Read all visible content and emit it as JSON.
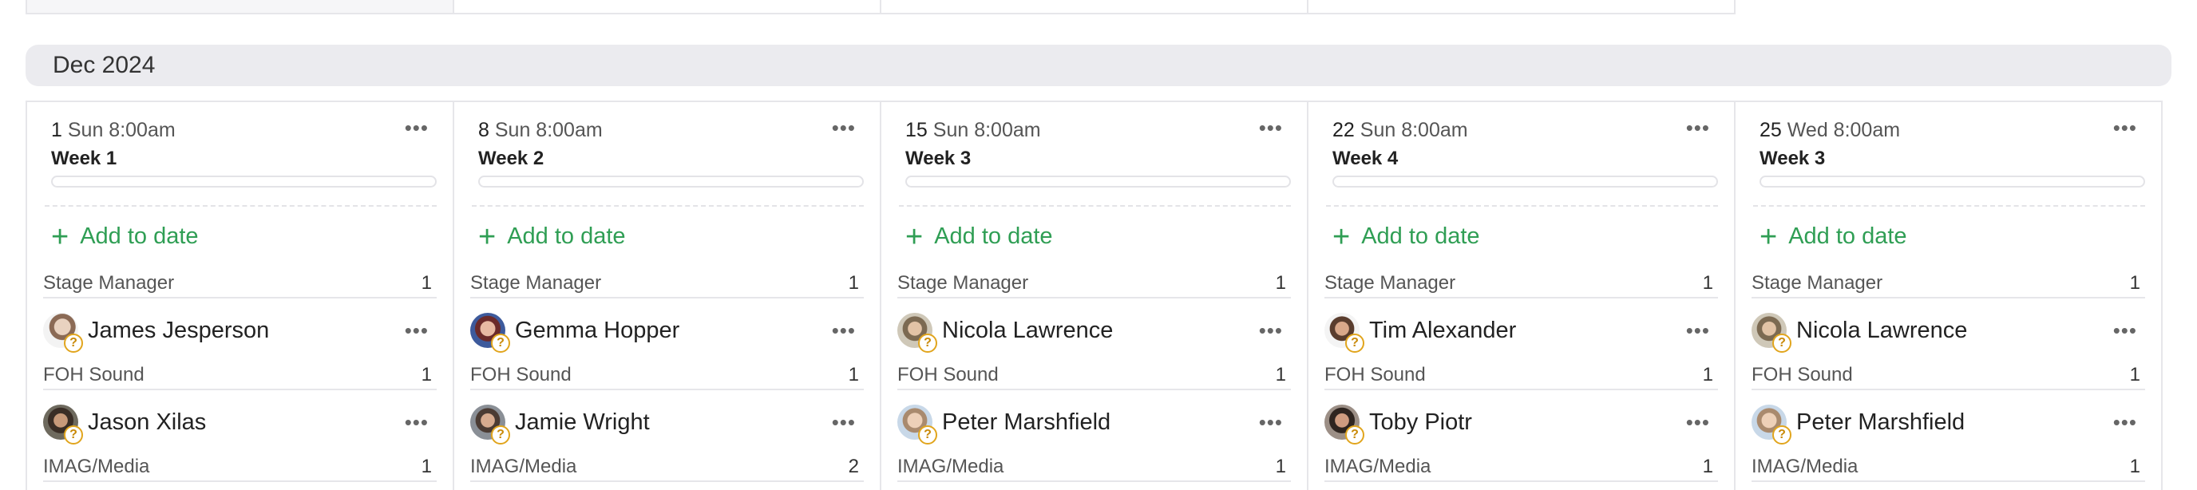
{
  "month": {
    "label": "Dec 2024"
  },
  "columns": [
    {
      "day": "1",
      "weekday_time": "Sun 8:00am",
      "week": "Week 1",
      "add_label": "Add to date",
      "roles": [
        {
          "name": "Stage Manager",
          "count": "1"
        },
        {
          "name": "FOH Sound",
          "count": "1"
        },
        {
          "name": "IMAG/Media",
          "count": "1"
        }
      ],
      "people": [
        {
          "name": "James Jesperson",
          "status": "?"
        },
        {
          "name": "Jason Xilas",
          "status": "?"
        }
      ]
    },
    {
      "day": "8",
      "weekday_time": "Sun 8:00am",
      "week": "Week 2",
      "add_label": "Add to date",
      "roles": [
        {
          "name": "Stage Manager",
          "count": "1"
        },
        {
          "name": "FOH Sound",
          "count": "1"
        },
        {
          "name": "IMAG/Media",
          "count": "2"
        }
      ],
      "people": [
        {
          "name": "Gemma Hopper",
          "status": "?"
        },
        {
          "name": "Jamie Wright",
          "status": "?"
        }
      ]
    },
    {
      "day": "15",
      "weekday_time": "Sun 8:00am",
      "week": "Week 3",
      "add_label": "Add to date",
      "roles": [
        {
          "name": "Stage Manager",
          "count": "1"
        },
        {
          "name": "FOH Sound",
          "count": "1"
        },
        {
          "name": "IMAG/Media",
          "count": "1"
        }
      ],
      "people": [
        {
          "name": "Nicola Lawrence",
          "status": "?"
        },
        {
          "name": "Peter Marshfield",
          "status": "?"
        }
      ]
    },
    {
      "day": "22",
      "weekday_time": "Sun 8:00am",
      "week": "Week 4",
      "add_label": "Add to date",
      "roles": [
        {
          "name": "Stage Manager",
          "count": "1"
        },
        {
          "name": "FOH Sound",
          "count": "1"
        },
        {
          "name": "IMAG/Media",
          "count": "1"
        }
      ],
      "people": [
        {
          "name": "Tim Alexander",
          "status": "?"
        },
        {
          "name": "Toby Piotr",
          "status": "?"
        }
      ]
    },
    {
      "day": "25",
      "weekday_time": "Wed 8:00am",
      "week": "Week 3",
      "add_label": "Add to date",
      "roles": [
        {
          "name": "Stage Manager",
          "count": "1"
        },
        {
          "name": "FOH Sound",
          "count": "1"
        },
        {
          "name": "IMAG/Media",
          "count": "1"
        }
      ],
      "people": [
        {
          "name": "Nicola Lawrence",
          "status": "?"
        },
        {
          "name": "Peter Marshfield",
          "status": "?"
        }
      ]
    }
  ],
  "icons": {
    "more": "more-dots-icon",
    "add": "plus-icon",
    "pending": "question-badge-icon"
  },
  "colors": {
    "accent_green": "#2f9e54",
    "pending_badge": "#e1a51d",
    "month_header_bg": "#ebebef"
  }
}
